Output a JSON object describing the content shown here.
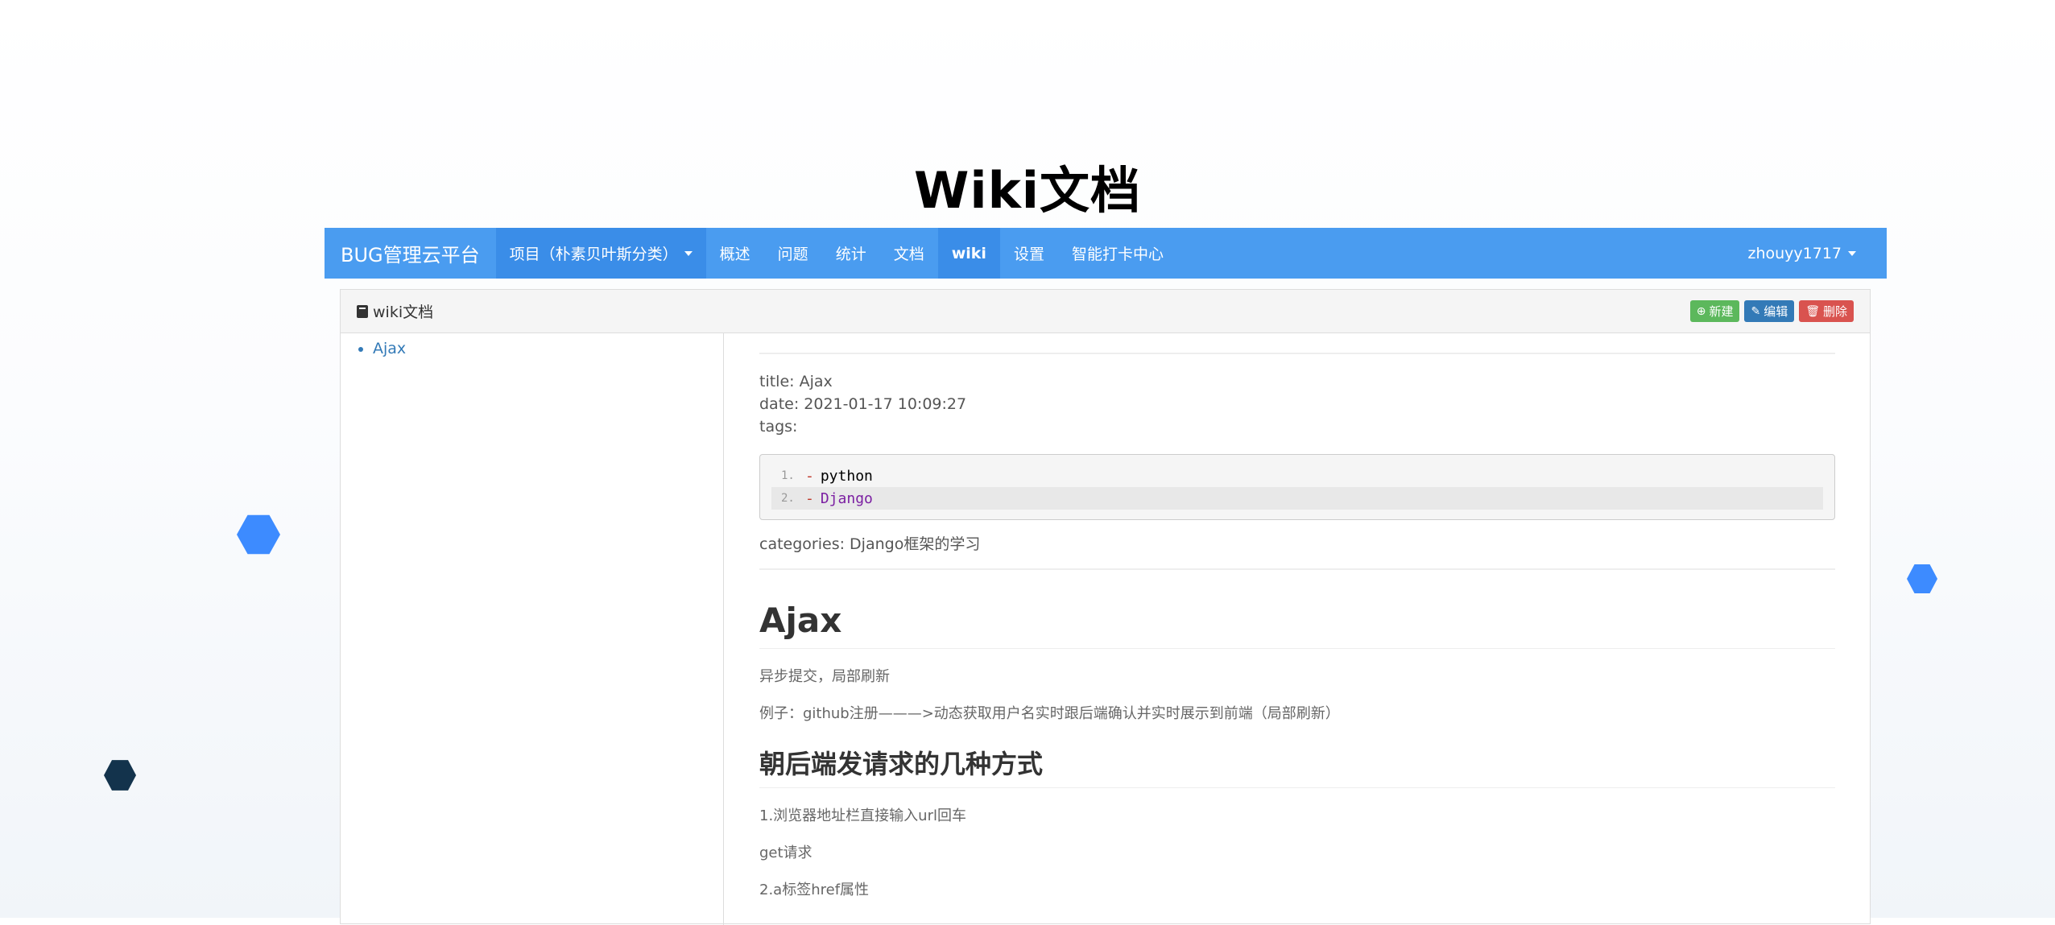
{
  "page_title": "Wiki文档",
  "navbar": {
    "brand": "BUG管理云平台",
    "items": [
      {
        "label": "项目（朴素贝叶斯分类）",
        "dropdown": true
      },
      {
        "label": "概述"
      },
      {
        "label": "问题"
      },
      {
        "label": "统计"
      },
      {
        "label": "文档"
      },
      {
        "label": "wiki",
        "active": true
      },
      {
        "label": "设置"
      },
      {
        "label": "智能打卡中心"
      }
    ],
    "user": "zhouyy1717"
  },
  "panel": {
    "heading": "wiki文档",
    "buttons": {
      "new": "新建",
      "edit": "编辑",
      "delete": "删除"
    }
  },
  "sidebar": {
    "items": [
      {
        "label": "Ajax"
      }
    ]
  },
  "content": {
    "meta": {
      "title": "title: Ajax",
      "date": "date: 2021-01-17 10:09:27",
      "tags": "tags:"
    },
    "code_lines": [
      {
        "num": "1.",
        "dash": "-",
        "text": "python"
      },
      {
        "num": "2.",
        "dash": "-",
        "text": "Django"
      }
    ],
    "categories": "categories: Django框架的学习",
    "h1": "Ajax",
    "p1": "异步提交，局部刷新",
    "p2": "例子：github注册———>动态获取用户名实时跟后端确认并实时展示到前端（局部刷新）",
    "h2": "朝后端发请求的几种方式",
    "p3": "1.浏览器地址栏直接输入url回车",
    "p4": "get请求",
    "p5": "2.a标签href属性"
  },
  "colors": {
    "navbar": "#4a9cf0",
    "hex_blue": "#3d8bff",
    "hex_dark": "#13334c"
  }
}
